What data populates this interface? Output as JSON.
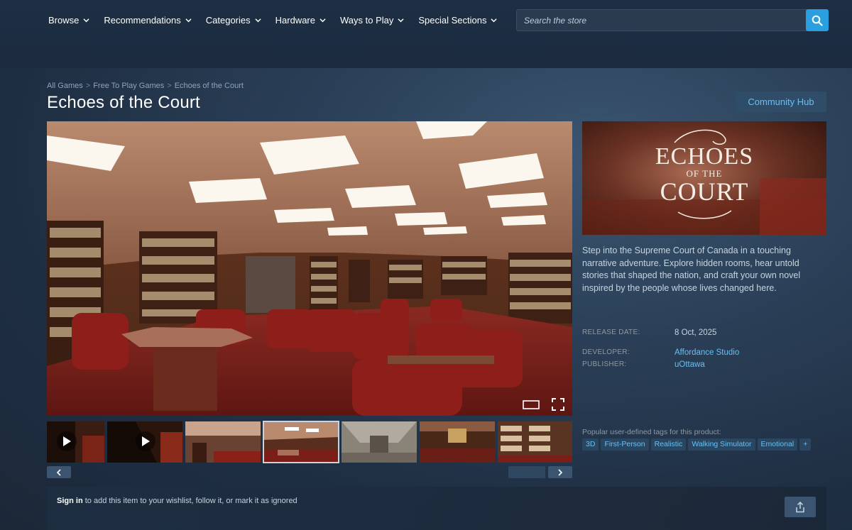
{
  "nav": {
    "items": [
      {
        "label": "Browse"
      },
      {
        "label": "Recommendations"
      },
      {
        "label": "Categories"
      },
      {
        "label": "Hardware"
      },
      {
        "label": "Ways to Play"
      },
      {
        "label": "Special Sections"
      }
    ],
    "search_placeholder": "Search the store"
  },
  "breadcrumb": [
    "All Games",
    "Free To Play Games",
    "Echoes of the Court"
  ],
  "game": {
    "title": "Echoes of the Court",
    "community_hub": "Community Hub",
    "capsule_logo": {
      "line1": "ECHOES",
      "line2": "OF THE",
      "line3": "COURT"
    },
    "description": "Step into the Supreme Court of Canada in a touching narrative adventure. Explore hidden rooms, hear untold stories that shaped the nation, and craft your own novel inspired by the people whose lives changed here.",
    "release_label": "RELEASE DATE:",
    "release_date": "8 Oct, 2025",
    "developer_label": "DEVELOPER:",
    "developer": "Affordance Studio",
    "publisher_label": "PUBLISHER:",
    "publisher": "uOttawa",
    "tags_label": "Popular user-defined tags for this product:",
    "tags": [
      "3D",
      "First-Person",
      "Realistic",
      "Walking Simulator",
      "Emotional",
      "+"
    ]
  },
  "signin": {
    "link": "Sign in",
    "text": " to add this item to your wishlist, follow it, or mark it as ignored"
  },
  "colors": {
    "accent": "#66c0f4",
    "search_button": "#2a9fe0",
    "background": "#1b2838"
  }
}
